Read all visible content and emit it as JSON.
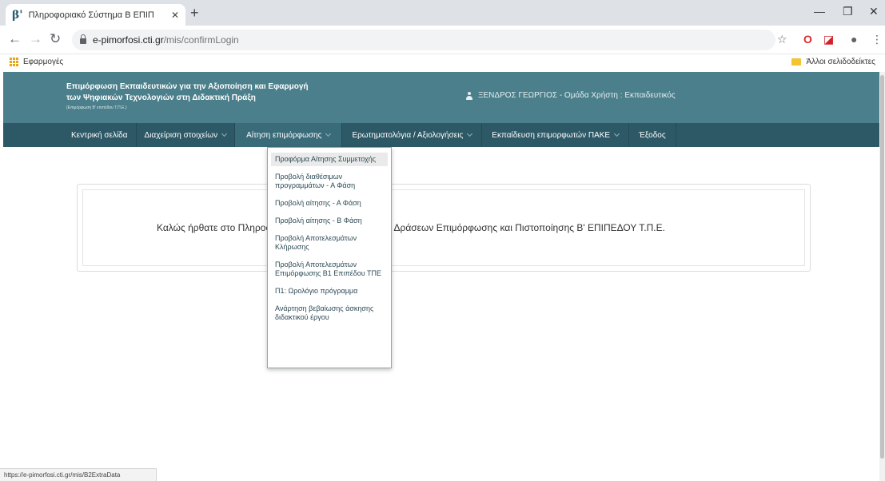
{
  "browser": {
    "tab": {
      "favicon": "β'",
      "title": "Πληροφοριακό Σύστημα Β ΕΠΙΠ",
      "close": "✕"
    },
    "new_tab": "+",
    "window": {
      "minimize": "—",
      "restore": "❐",
      "close": "✕"
    },
    "nav": {
      "back": "←",
      "forward": "→",
      "reload": "↻"
    },
    "url": {
      "domain": "e-pimorfosi.cti.gr",
      "path": "/mis/confirmLogin"
    },
    "toolbar_icons": {
      "bookmark": "☆",
      "opera": "O",
      "pdf": "◪",
      "account": "●",
      "menu": "⋮"
    },
    "bookmarks": {
      "apps_label": "Εφαρμογές",
      "other_label": "Άλλοι σελιδοδείκτες"
    },
    "status_url": "https://e-pimorfosi.cti.gr/mis/B2ExtraData"
  },
  "header": {
    "title_line1": "Επιμόρφωση Εκπαιδευτικών για την Αξιοποίηση και Εφαρμογή",
    "title_line2": "των Ψηφιακών Τεχνολογιών στη Διδακτική Πράξη",
    "subtitle": "(Επιμόρφωση Β' επιπέδου Τ.Π.Ε.)",
    "user": "ΞΕΝΔΡΟΣ ΓΕΩΡΓΙΟΣ - Ομάδα Χρήστη : Εκπαιδευτικός"
  },
  "nav": {
    "items": [
      {
        "label": "Κεντρική σελίδα"
      },
      {
        "label": "Διαχείριση στοιχείων"
      },
      {
        "label": "Αίτηση επιμόρφωσης"
      },
      {
        "label": "Ερωτηματολόγια / Αξιολογήσεις"
      },
      {
        "label": "Εκπαίδευση επιμορφωτών ΠΑΚΕ"
      },
      {
        "label": "Έξοδος"
      }
    ]
  },
  "welcome": "Καλώς ήρθατε στο Πληροφοριακό Σύστημα Διαχείρισης Δράσεων Επιμόρφωσης και Πιστοποίησης Β' ΕΠΙΠΕΔΟΥ Τ.Π.Ε.",
  "dropdown": {
    "items": [
      {
        "label": "Προφόρμα Αίτησης Συμμετοχής"
      },
      {
        "label": "Προβολή διαθέσιμων προγραμμάτων - Α Φάση"
      },
      {
        "label": "Προβολή αίτησης - Α Φάση"
      },
      {
        "label": "Προβολή αίτησης - Β Φάση"
      },
      {
        "label": "Προβολή Αποτελεσμάτων Κλήρωσης"
      },
      {
        "label": "Προβολή Αποτελεσμάτων Επιμόρφωσης Β1 Επιπέδου ΤΠΕ"
      },
      {
        "label": "Π1: Ωρολόγιο πρόγραμμα"
      },
      {
        "label": "Ανάρτηση βεβαίωσης άσκησης διδακτικού έργου"
      }
    ]
  },
  "colors": {
    "header": "#4b7f8b",
    "nav": "#2d5866",
    "nav_active": "#3a6b79"
  }
}
